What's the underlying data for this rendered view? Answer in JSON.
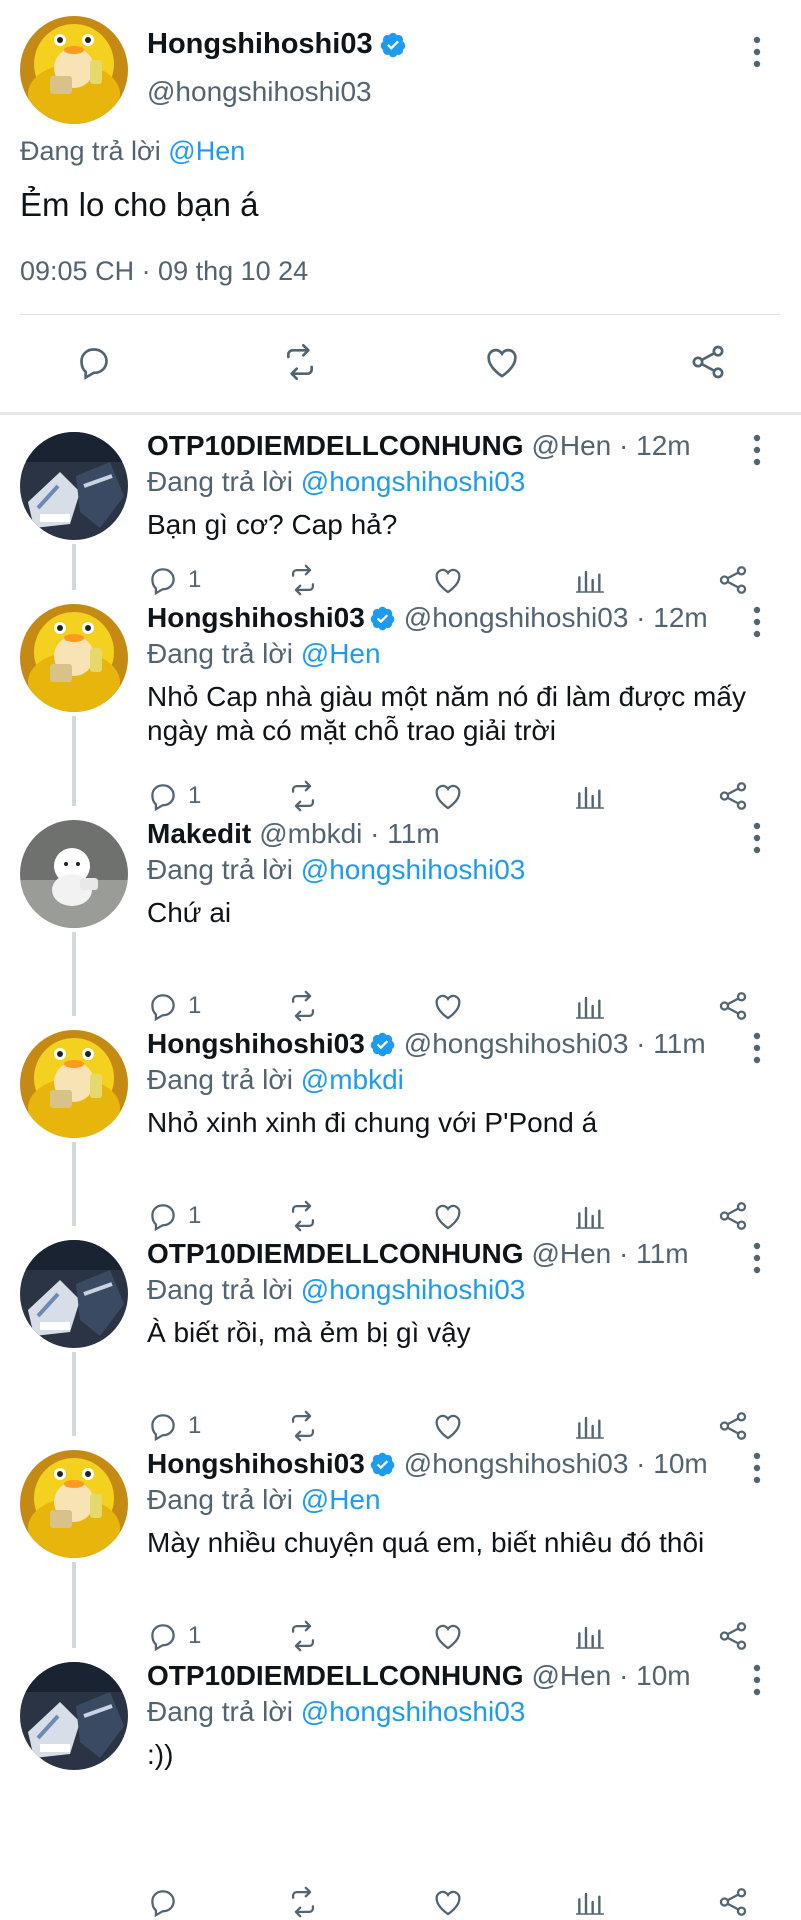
{
  "main_tweet": {
    "author_name": "Hongshihoshi03",
    "author_handle": "@hongshihoshi03",
    "replying_prefix": "Đang trả lời",
    "replying_to": "@Hen",
    "text": "Ẻm lo cho bạn á",
    "timestamp": "09:05 CH · 09 thg 10 24"
  },
  "replies": [
    {
      "name": "OTP10DIEMDELLCONHUNG",
      "handle": "@Hen",
      "time": "12m",
      "verified": false,
      "replying_prefix": "Đang trả lời",
      "replying_to": "@hongshihoshi03",
      "text": "Bạn gì cơ? Cap hả?",
      "reply_count": "1"
    },
    {
      "name": "Hongshihoshi03",
      "handle": "@hongshihoshi03",
      "time": "12m",
      "verified": true,
      "replying_prefix": "Đang trả lời",
      "replying_to": "@Hen",
      "text": "Nhỏ Cap nhà giàu một năm nó đi làm được mấy ngày mà có mặt chỗ trao giải trời",
      "reply_count": "1"
    },
    {
      "name": "Makedit",
      "handle": "@mbkdi",
      "time": "11m",
      "verified": false,
      "replying_prefix": "Đang trả lời",
      "replying_to": "@hongshihoshi03",
      "text": "Chứ ai",
      "reply_count": "1"
    },
    {
      "name": "Hongshihoshi03",
      "handle": "@hongshihoshi03",
      "time": "11m",
      "verified": true,
      "replying_prefix": "Đang trả lời",
      "replying_to": "@mbkdi",
      "text": "Nhỏ xinh xinh đi chung với P'Pond á",
      "reply_count": "1"
    },
    {
      "name": "OTP10DIEMDELLCONHUNG",
      "handle": "@Hen",
      "time": "11m",
      "verified": false,
      "replying_prefix": "Đang trả lời",
      "replying_to": "@hongshihoshi03",
      "text": "À biết rồi, mà ẻm bị gì vậy",
      "reply_count": "1"
    },
    {
      "name": "Hongshihoshi03",
      "handle": "@hongshihoshi03",
      "time": "10m",
      "verified": true,
      "replying_prefix": "Đang trả lời",
      "replying_to": "@Hen",
      "text": "Mày nhiều chuyện quá em, biết nhiêu đó thôi",
      "reply_count": "1"
    },
    {
      "name": "OTP10DIEMDELLCONHUNG",
      "handle": "@Hen",
      "time": "10m",
      "verified": false,
      "replying_prefix": "Đang trả lời",
      "replying_to": "@hongshihoshi03",
      "text": ":))",
      "reply_count": ""
    }
  ],
  "separator": "·",
  "icons": {
    "verified": "verified-badge-icon",
    "more": "more-vertical-icon",
    "reply": "reply-icon",
    "retweet": "retweet-icon",
    "like": "like-icon",
    "views": "views-icon",
    "share": "share-icon"
  },
  "colors": {
    "link": "#1d9bf0",
    "text_primary": "#0f1419",
    "text_secondary": "#536471",
    "verified": "#1d9bf0",
    "thread_line": "#cfd9de"
  }
}
